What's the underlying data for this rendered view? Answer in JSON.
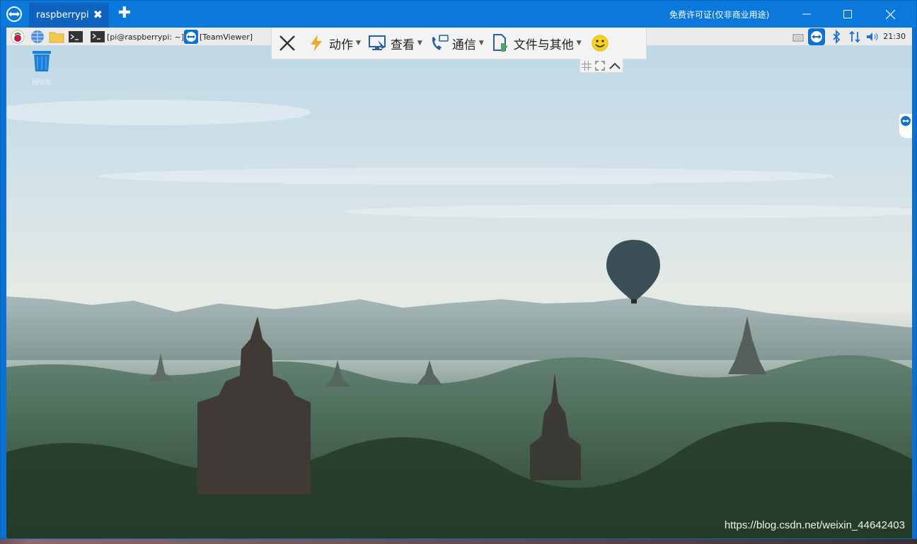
{
  "window": {
    "tab_label": "raspberrypi",
    "license_text": "免费许可证(仅非商业用途)",
    "new_tab_symbol": "✚",
    "tab_close_symbol": "✖"
  },
  "panel": {
    "tasks": [
      {
        "label": "[pi@raspberrypi: ~]"
      },
      {
        "label": "[TeamViewer]"
      }
    ],
    "clock": "21:30"
  },
  "toolbar": {
    "items": [
      {
        "label": "动作"
      },
      {
        "label": "查看"
      },
      {
        "label": "通信"
      },
      {
        "label": "文件与其他"
      }
    ]
  },
  "desktop": {
    "trash_label": "回收站"
  },
  "watermark": "https://blog.csdn.net/weixin_44642403",
  "colors": {
    "titlebar": "#0b78dc",
    "tab_active": "#0d63bd",
    "panel": "#ecebeb",
    "toolbar": "#f3f3f3"
  },
  "icons": {
    "app": "teamviewer-icon",
    "panel": [
      "raspberry-menu-icon",
      "web-browser-icon",
      "file-manager-icon",
      "terminal-icon"
    ],
    "tray": [
      "keyboard-icon",
      "teamviewer-tray-icon",
      "bluetooth-icon",
      "network-icon",
      "volume-icon"
    ],
    "toolbar": [
      "close-icon",
      "lightning-icon",
      "monitor-icon",
      "phone-chat-icon",
      "file-puzzle-icon",
      "smiley-icon"
    ]
  }
}
